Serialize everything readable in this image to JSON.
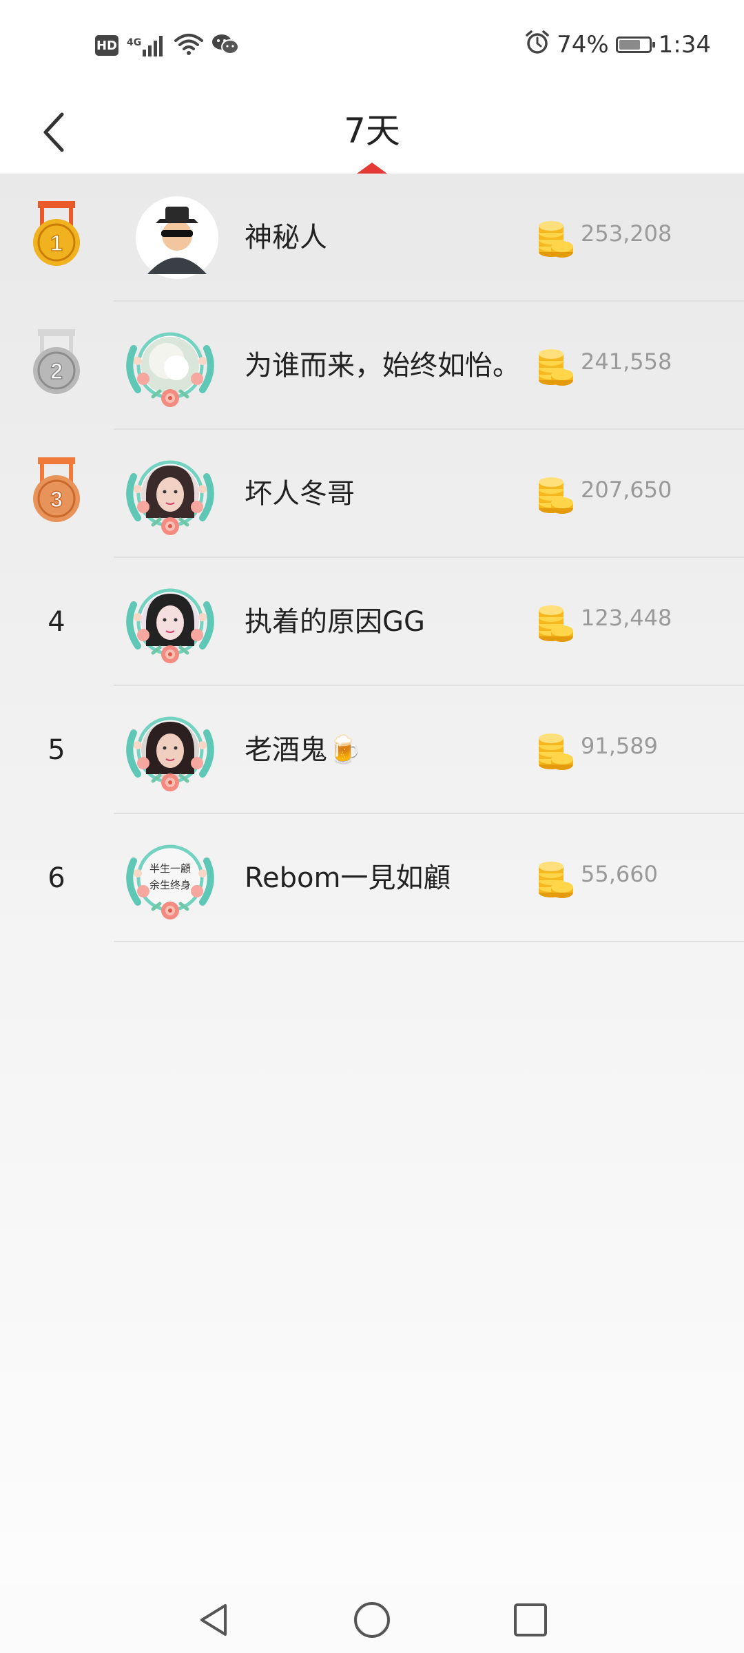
{
  "status_bar": {
    "hd_label": "HD",
    "network_label": "4G",
    "battery_percent": "74%",
    "battery_level": 0.74,
    "time": "1:34"
  },
  "header": {
    "title": "7天"
  },
  "rankings": [
    {
      "rank": "1",
      "name": "神秘人",
      "coins": "253,208"
    },
    {
      "rank": "2",
      "name": "为谁而来，始终如怡。",
      "coins": "241,558"
    },
    {
      "rank": "3",
      "name": "坏人冬哥",
      "coins": "207,650"
    },
    {
      "rank": "4",
      "name": "执着的原因GG",
      "coins": "123,448"
    },
    {
      "rank": "5",
      "name": "老酒鬼🍺",
      "coins": "91,589"
    },
    {
      "rank": "6",
      "name": "Rebom一見如顧",
      "coins": "55,660"
    }
  ],
  "avatar_text": "半生一顧余生终身",
  "colors": {
    "accent": "#e53935",
    "gold": "#f0b21e",
    "silver": "#b8b8b8",
    "bronze": "#e8935a"
  }
}
